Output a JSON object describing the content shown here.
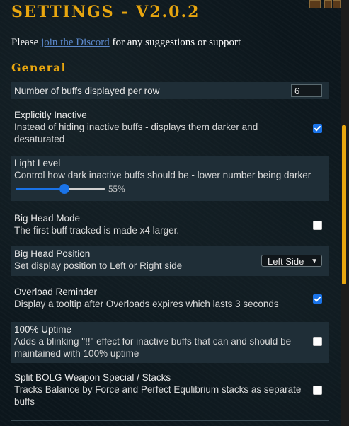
{
  "header": {
    "title": "SETTINGS - V2.0.2"
  },
  "intro": {
    "prefix": "Please",
    "link": "join the Discord",
    "suffix": "for any suggestions or support"
  },
  "section": {
    "general": "General"
  },
  "settings": {
    "buffs_per_row": {
      "label": "Number of buffs displayed per row",
      "value": "6"
    },
    "explicitly_inactive": {
      "label": "Explicitly Inactive",
      "desc": "Instead of hiding inactive buffs - displays them darker and desaturated",
      "checked": true
    },
    "light_level": {
      "label": "Light Level",
      "desc": "Control how dark inactive buffs should be - lower number being darker",
      "value_text": "55%",
      "value": 55
    },
    "big_head_mode": {
      "label": "Big Head Mode",
      "desc": "The first buff tracked is made x4 larger.",
      "checked": false
    },
    "big_head_position": {
      "label": "Big Head Position",
      "desc": "Set display position to Left or Right side",
      "selected": "Left Side"
    },
    "overload_reminder": {
      "label": "Overload Reminder",
      "desc": "Display a tooltip after Overloads expires which lasts 3 seconds",
      "checked": true
    },
    "uptime": {
      "label": "100% Uptime",
      "desc": "Adds a blinking \"!!\" effect for inactive buffs that can and should be maintained with 100% uptime",
      "checked": false
    },
    "split_bolg": {
      "label": "Split BOLG Weapon Special / Stacks",
      "desc": "Tracks Balance by Force and Perfect Equlibrium stacks as separate buffs",
      "checked": false
    }
  },
  "colors": {
    "accent": "#e8a60f",
    "checkbox": "#1a73e8",
    "link": "#5b87c9",
    "row_bg": "#1f2e37"
  }
}
